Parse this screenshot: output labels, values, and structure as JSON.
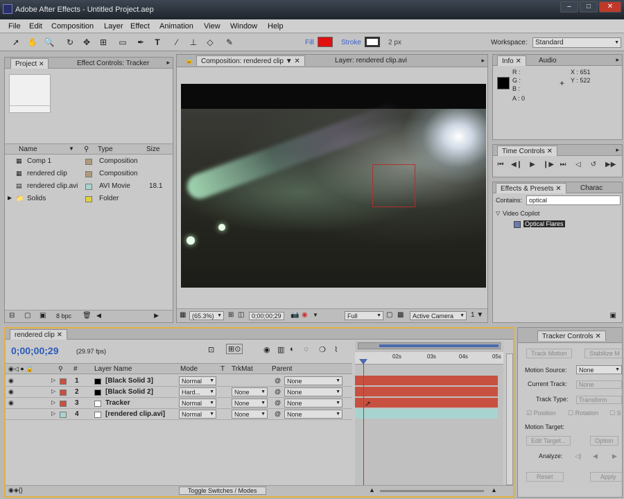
{
  "window": {
    "title": "Adobe After Effects - Untitled Project.aep"
  },
  "menu": [
    "File",
    "Edit",
    "Composition",
    "Layer",
    "Effect",
    "Animation",
    "View",
    "Window",
    "Help"
  ],
  "toolbar": {
    "fill_label": "Fill",
    "stroke_label": "Stroke",
    "stroke_width": "2 px",
    "workspace_label": "Workspace:",
    "workspace_value": "Standard",
    "fill_color": "#e01010"
  },
  "project_panel": {
    "tabs": [
      "Project",
      "Effect Controls: Tracker"
    ],
    "columns": {
      "name": "Name",
      "type": "Type",
      "size": "Size"
    },
    "items": [
      {
        "name": "Comp 1",
        "type": "Composition",
        "size": "",
        "color": "#b09a7a"
      },
      {
        "name": "rendered clip",
        "type": "Composition",
        "size": "",
        "color": "#b09a7a"
      },
      {
        "name": "rendered clip.avi",
        "type": "AVI Movie",
        "size": "18.1",
        "color": "#a8d4d0"
      },
      {
        "name": "Solids",
        "type": "Folder",
        "size": "",
        "color": "#e0d040"
      }
    ],
    "bpc": "8 bpc"
  },
  "comp_panel": {
    "tabs": [
      "Composition: rendered clip",
      "Layer: rendered clip.avi"
    ],
    "zoom": "(65.3%)",
    "timecode": "0;00;00;29",
    "resolution": "Full",
    "camera": "Active Camera"
  },
  "info_panel": {
    "tabs": [
      "Info",
      "Audio"
    ],
    "r": "R :",
    "g": "G :",
    "b": "B :",
    "a": "A : 0",
    "x": "X : 651",
    "y": "Y : 522"
  },
  "time_controls": {
    "tab": "Time Controls"
  },
  "effects_panel": {
    "tabs": [
      "Effects & Presets",
      "Charac"
    ],
    "contains_label": "Contains:",
    "contains_value": "optical",
    "category": "Video Copilot",
    "item": "Optical Flares"
  },
  "timeline": {
    "tab": "rendered clip",
    "timecode": "0;00;00;29",
    "fps": "(29.97 fps)",
    "columns": {
      "num": "#",
      "layer_name": "Layer Name",
      "mode": "Mode",
      "t": "T",
      "trkmat": "TrkMat",
      "parent": "Parent"
    },
    "ruler": [
      "02s",
      "03s",
      "04s",
      "05s"
    ],
    "layers": [
      {
        "num": "1",
        "name": "[Black Solid 3]",
        "mode": "Normal",
        "trkmat": "",
        "parent": "None",
        "color": "#c85040",
        "swatch": "#000000"
      },
      {
        "num": "2",
        "name": "[Black Solid 2]",
        "mode": "Hard...",
        "trkmat": "None",
        "parent": "None",
        "color": "#c85040",
        "swatch": "#000000"
      },
      {
        "num": "3",
        "name": "Tracker",
        "mode": "Normal",
        "trkmat": "None",
        "parent": "None",
        "color": "#c85040",
        "swatch": "#ffffff"
      },
      {
        "num": "4",
        "name": "[rendered clip.avi]",
        "mode": "Normal",
        "trkmat": "None",
        "parent": "None",
        "color": "#a8d4d0",
        "swatch": "#ffffff"
      }
    ],
    "toggle_label": "Toggle Switches / Modes"
  },
  "tracker_panel": {
    "tab": "Tracker Controls",
    "track_motion": "Track Motion",
    "stabilize": "Stabilize M",
    "motion_source_label": "Motion Source:",
    "motion_source_value": "None",
    "current_track_label": "Current Track:",
    "current_track_value": "None",
    "track_type_label": "Track Type:",
    "track_type_value": "Transform",
    "position": "Position",
    "rotation": "Rotation",
    "s": "S",
    "motion_target_label": "Motion Target:",
    "edit_target": "Edit Target...",
    "options": "Option",
    "analyze_label": "Analyze:",
    "reset": "Reset",
    "apply": "Apply"
  }
}
